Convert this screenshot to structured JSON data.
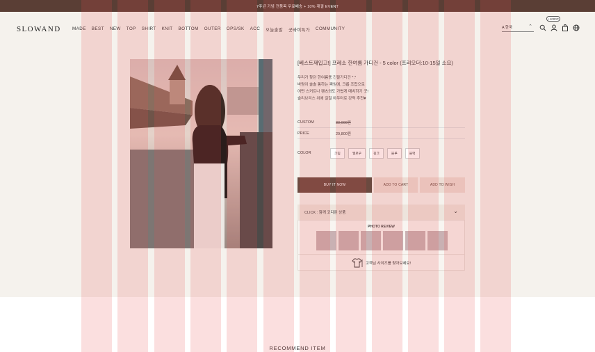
{
  "topbar": {
    "text": "7주년 기념 전품목 무료배송 + 10% 재결 EVENT"
  },
  "header": {
    "logo": "SLOWAND",
    "nav": [
      "MADE",
      "BEST",
      "NEW",
      "TOP",
      "SHIRT",
      "KNIT",
      "BOTTOM",
      "OUTER",
      "OPS/SK",
      "ACC",
      "오늘출발",
      "굿바이특가",
      "COMMUNITY"
    ],
    "lang": "A 한국",
    "badge": "+1000P"
  },
  "product": {
    "title": "[베스트재입고!] 프레소 한여름 가디건 - 5 color (프리오더:10-15일 소요)",
    "description": [
      "우리가 찾던 한여름용 긴팔가디건 *.*",
      "바람이 솔솔 통하는 짜임에, 크롭 조합으로",
      "어떤 스커트나 팬츠와도 가볍게 매치하기 굿!",
      "슬리브리스 위에 걸칠 아우터로 강력 추천♥"
    ],
    "custom_label": "CUSTOM",
    "custom_price": "33,000원",
    "price_label": "PRICE",
    "price": "29,800원",
    "color_label": "COLOR",
    "colors": [
      "크림",
      "옐로우",
      "핑크",
      "블루",
      "블랙"
    ],
    "buy_label": "BUY IT NOW",
    "cart_label": "ADD TO CART",
    "wish_label": "ADD TO WISH",
    "click_label": "CLICK : 함께 코디된 상품",
    "review_title": "PHOTO REVIEW",
    "size_text": "고객님 사이즈를 찾아보세요!"
  },
  "recommend": {
    "title": "RECOMMEND ITEM"
  },
  "colors": {
    "brand": "#6b4a40",
    "topbar": "#5a3e35",
    "background": "#f5f2ed"
  }
}
